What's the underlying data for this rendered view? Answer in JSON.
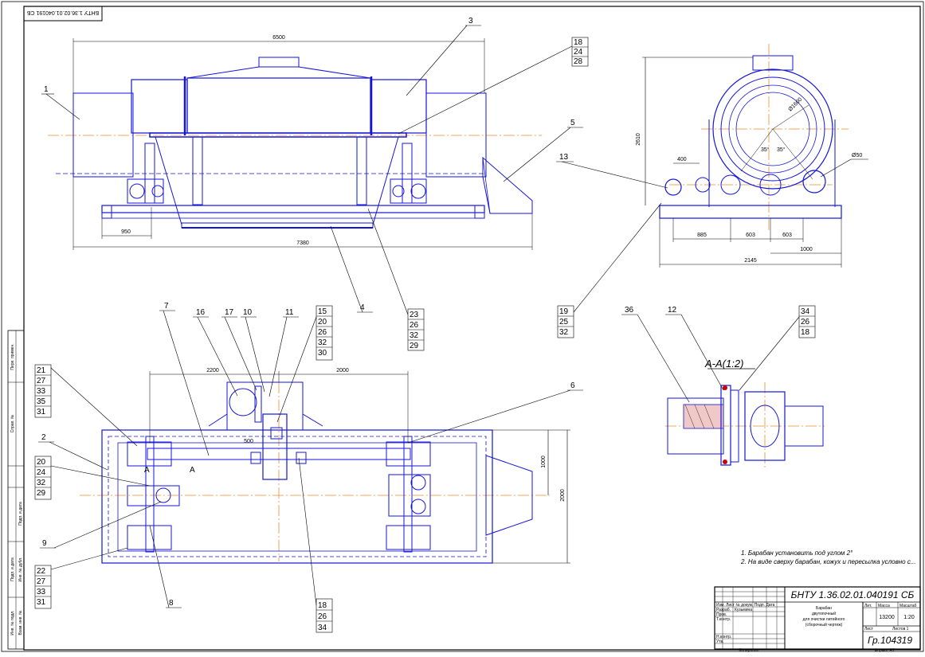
{
  "drawing": {
    "code": "БНТУ 1.36.02.01.040191 СБ",
    "code_mirrored": "БНТУ 1.36.02.01.040191 СБ",
    "group": "Гр.104319",
    "title_lines": [
      "Барабан",
      "двутопочный",
      "для очистки литейного",
      "(сборочный чертеж)"
    ],
    "mass": "13200",
    "scale": "1:20",
    "lit_header": "Лит.",
    "mass_header": "Масса",
    "scale_header": "Масштаб",
    "sheet_label": "Лист",
    "sheets_label": "Листов 1",
    "copied": "Копировал",
    "format": "Формат А1",
    "tb_rows": [
      "Изм. Лист № докум. Подп. Дата",
      "Разраб.",
      "Пров.",
      "Т.контр.",
      "Н.контр.",
      "Утв."
    ],
    "tb_name": "Кузьмина"
  },
  "notes": [
    "1. Барабан установить под углом 2°",
    "2. На виде сверху барабан, кожух и пересылка условно с..."
  ],
  "section_label": "A-A(1:2)",
  "section_marks": [
    "A",
    "A"
  ],
  "dimensions": {
    "top_overall": "6500",
    "top_left": "950",
    "top_bottom": "7380",
    "side_height": "2610",
    "side_400": "400",
    "side_885": "885",
    "side_603a": "603",
    "side_603b": "603",
    "side_1000": "1000",
    "side_2145": "2145",
    "side_d1600": "Ø1600",
    "side_d50": "Ø50",
    "side_35a": "35°",
    "side_35b": "35°",
    "plan_2200": "2200",
    "plan_2000": "2000",
    "plan_500": "500",
    "plan_1000": "1000",
    "plan_2000v": "2000"
  },
  "callouts": {
    "c1": "1",
    "c2": "2",
    "c3": "3",
    "c4": "4",
    "c5": "5",
    "c6": "6",
    "c7": "7",
    "c8": "8",
    "c9": "9",
    "c10": "10",
    "c11": "11",
    "c12": "12",
    "c13": "13",
    "c16": "16",
    "c17": "17",
    "c36": "36",
    "s_18_24_28": [
      "18",
      "24",
      "28"
    ],
    "s_15": [
      "15",
      "20",
      "26",
      "32",
      "30"
    ],
    "s_23": [
      "23",
      "26",
      "32",
      "29"
    ],
    "s_19": [
      "19",
      "25",
      "32"
    ],
    "s_34": [
      "34",
      "26",
      "18"
    ],
    "s_21": [
      "21",
      "27",
      "33",
      "35",
      "31"
    ],
    "s_20": [
      "20",
      "24",
      "32",
      "29"
    ],
    "s_22": [
      "22",
      "27",
      "33",
      "31"
    ],
    "s_18b": [
      "18",
      "26",
      "34"
    ]
  },
  "side_strip": [
    "Перв. примен.",
    "Справ. №",
    "Подп. и дата",
    "Инв. № дубл.",
    "Взам. инв. №",
    "Подп. и дата",
    "Инв. № подл."
  ],
  "colors": {
    "outline": "#1515d8",
    "axis": "#e8902a",
    "ink": "#000000",
    "accent": "#d00000"
  }
}
